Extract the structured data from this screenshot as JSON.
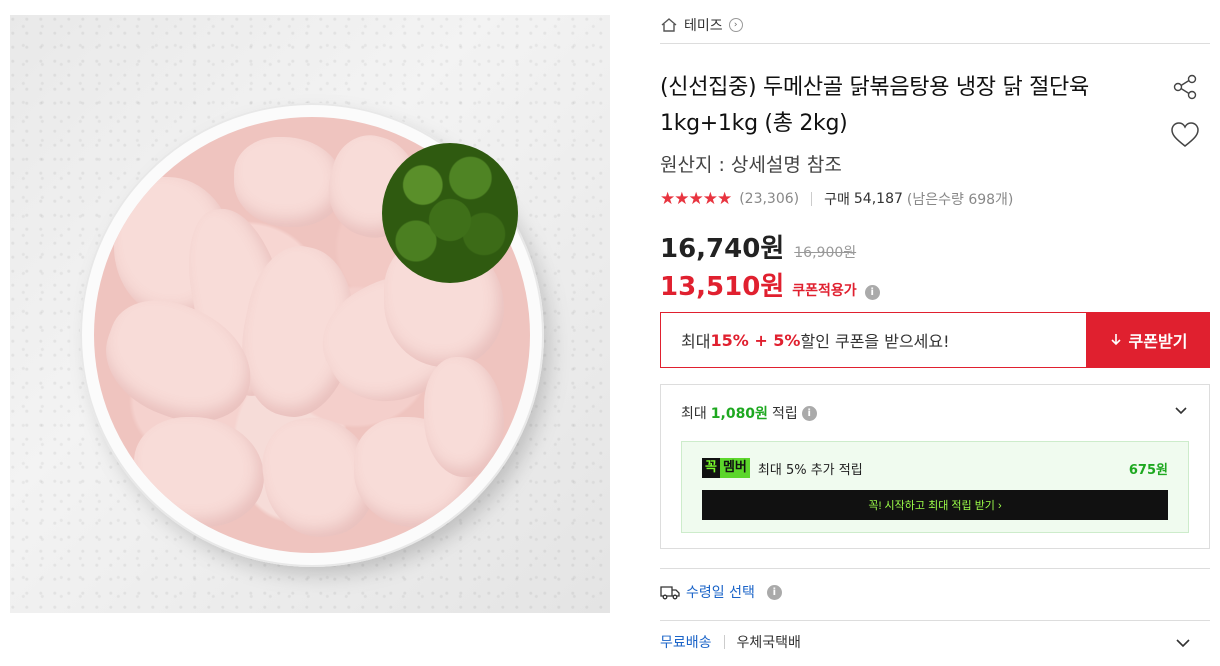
{
  "product_image": {
    "alt_icon": "chicken-product-photo"
  },
  "breadcrumb": {
    "seller": "테미즈",
    "home_icon": "home-icon"
  },
  "product": {
    "title": "(신선집중) 두메산골 닭볶음탕용 냉장 닭 절단육 1kg+1kg (총 2kg)",
    "origin": "원산지 : 상세설명 참조",
    "rating_stars": "★★★★★",
    "rating_value": 4.5,
    "review_count": "(23,306)",
    "buy_label": "구매",
    "buy_count": "54,187",
    "stock_note": "(남은수량 698개)"
  },
  "price": {
    "sale": "16,740원",
    "original": "16,900원",
    "coupon_price": "13,510원",
    "coupon_label": "쿠폰적용가"
  },
  "coupon": {
    "text_prefix": "최대 ",
    "text_highlight": "15% + 5%",
    "text_suffix": " 할인 쿠폰을 받으세요!",
    "button_label": "쿠폰받기"
  },
  "points": {
    "prefix": "최대 ",
    "amount": "1,080원",
    "suffix": " 적립",
    "member": {
      "badge_left": "꼭",
      "badge_right": "멤버",
      "text": "최대 5% 추가 적립",
      "amount": "675원",
      "button_label": "꼭! 시작하고 최대 적립 받기 ›"
    }
  },
  "delivery": {
    "label": "수령일 선택"
  },
  "shipping": {
    "free_label": "무료배송",
    "carrier": "우체국택배"
  },
  "colors": {
    "accent_red": "#e0202f",
    "point_green": "#1ea820",
    "link_blue": "#1b64c8"
  }
}
